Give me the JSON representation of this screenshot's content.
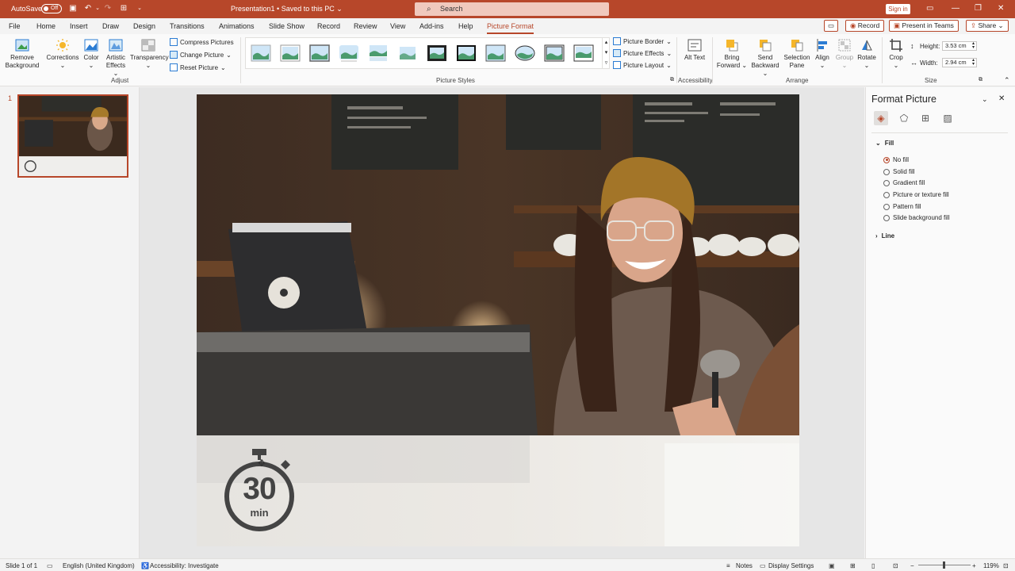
{
  "titlebar": {
    "autosave_label": "AutoSave",
    "autosave_state": "Off",
    "doc_title": "Presentation1 • Saved to this PC ⌄",
    "search_placeholder": "Search",
    "signin_label": "Sign in"
  },
  "menu": {
    "tabs": [
      "File",
      "Home",
      "Insert",
      "Draw",
      "Design",
      "Transitions",
      "Animations",
      "Slide Show",
      "Record",
      "Review",
      "View",
      "Add-ins",
      "Help",
      "Picture Format"
    ],
    "active_tab": "Picture Format",
    "record_button": "Record",
    "present_button": "Present in Teams",
    "share_button": "Share"
  },
  "ribbon": {
    "remove_background": "Remove Background",
    "corrections": "Corrections",
    "color": "Color",
    "artistic_effects": "Artistic Effects",
    "transparency": "Transparency",
    "compress": "Compress Pictures",
    "change_picture": "Change Picture",
    "reset_picture": "Reset Picture",
    "group_adjust": "Adjust",
    "picture_border": "Picture Border",
    "picture_effects": "Picture Effects",
    "picture_layout": "Picture Layout",
    "group_styles": "Picture Styles",
    "alt_text": "Alt Text",
    "group_accessibility": "Accessibility",
    "bring_forward": "Bring Forward",
    "send_backward": "Send Backward",
    "selection_pane": "Selection Pane",
    "align": "Align",
    "group": "Group",
    "rotate": "Rotate",
    "group_arrange": "Arrange",
    "crop": "Crop",
    "height_label": "Height:",
    "height_value": "3.53 cm",
    "width_label": "Width:",
    "width_value": "2.94 cm",
    "group_size": "Size"
  },
  "thumbnails": {
    "slide_number": "1"
  },
  "slide": {
    "timer_number": "30",
    "timer_unit": "min"
  },
  "format_pane": {
    "title": "Format Picture",
    "fill_section": "Fill",
    "options": [
      "No fill",
      "Solid fill",
      "Gradient fill",
      "Picture or texture fill",
      "Pattern fill",
      "Slide background fill"
    ],
    "selected_option": "No fill",
    "line_section": "Line"
  },
  "statusbar": {
    "slide_info": "Slide 1 of 1",
    "language": "English (United Kingdom)",
    "accessibility": "Accessibility: Investigate",
    "notes": "Notes",
    "display_settings": "Display Settings",
    "zoom": "119%"
  },
  "colors": {
    "accent": "#b7472a"
  }
}
